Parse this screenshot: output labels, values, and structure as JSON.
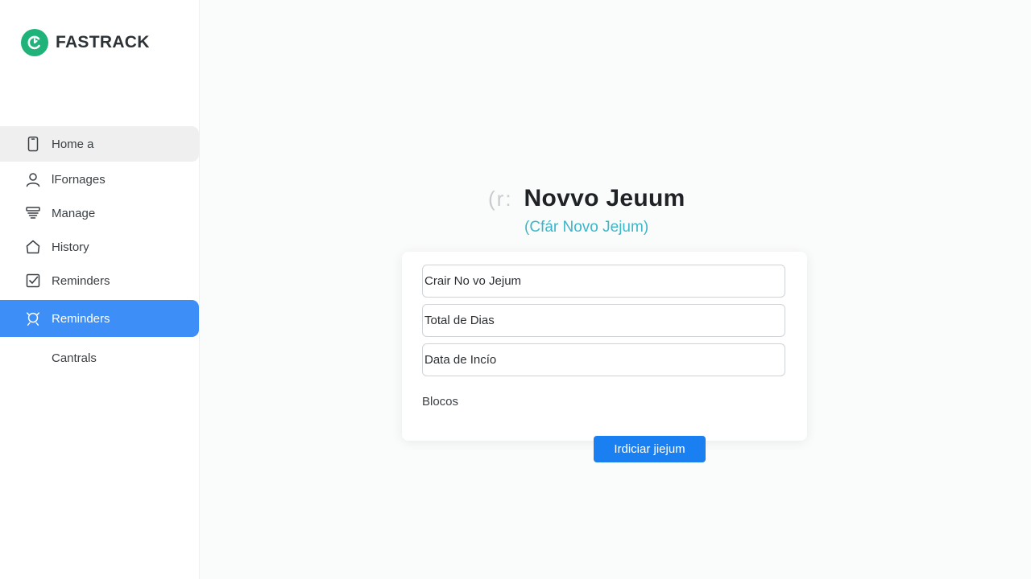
{
  "app": {
    "brand_name": "FASTRACK",
    "brand_color": "#1fb37a"
  },
  "sidebar": {
    "items": [
      {
        "label": "Home a",
        "icon": "phone-icon",
        "state": "hover"
      },
      {
        "label": "lFornages",
        "icon": "user-icon",
        "state": "normal"
      },
      {
        "label": "Manage",
        "icon": "layers-icon",
        "state": "normal"
      },
      {
        "label": "History",
        "icon": "home-icon",
        "state": "normal"
      },
      {
        "label": "Reminders",
        "icon": "checkbox-icon",
        "state": "normal"
      },
      {
        "label": "Reminders",
        "icon": "reminder-search-icon",
        "state": "active"
      },
      {
        "label": "Cantrals",
        "icon": "",
        "state": "normal"
      }
    ],
    "active_color": "#3d8ef6"
  },
  "main": {
    "title_prefix": "(r:",
    "title": "Novvo Jeuum",
    "subtitle": "(Cfár Novo Jejum)",
    "form": {
      "fields": [
        {
          "value": "Crair No vo Jejum"
        },
        {
          "value": "Total de Dias"
        },
        {
          "value": "Data de Incío"
        }
      ],
      "blocks_label": "Blocos"
    },
    "start_button": "Irdiciar jiejum",
    "accent_color": "#1a7ff0"
  }
}
